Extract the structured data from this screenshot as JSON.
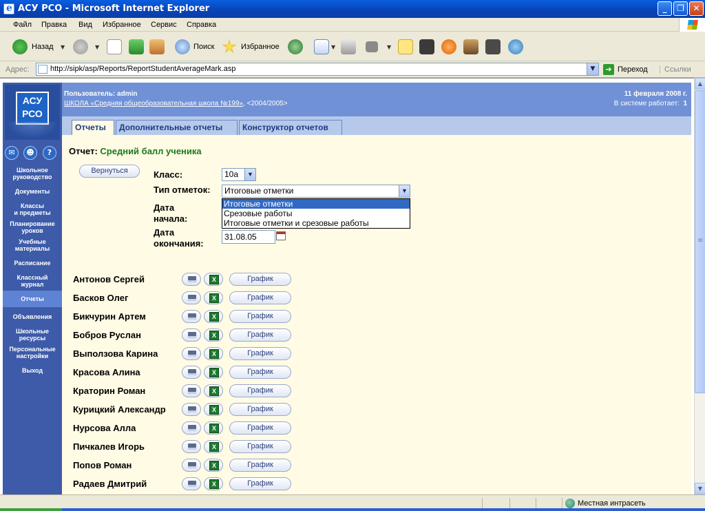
{
  "window": {
    "title": "АСУ РСО - Microsoft Internet Explorer",
    "controls": [
      "_",
      "❐",
      "✕"
    ]
  },
  "menu": [
    "Файл",
    "Правка",
    "Вид",
    "Избранное",
    "Сервис",
    "Справка"
  ],
  "toolbar": {
    "back_label": "Назад",
    "search_label": "Поиск",
    "favorites_label": "Избранное"
  },
  "address": {
    "label": "Адрес:",
    "url": "http://sipk/asp/Reports/ReportStudentAverageMark.asp",
    "go_label": "Переход",
    "links_label": "Ссылки"
  },
  "logo": {
    "line1": "АСУ",
    "line2": "РСО"
  },
  "sidebar": {
    "icons": [
      "mail-icon",
      "users-icon",
      "help-icon"
    ],
    "items": [
      {
        "label": "Школьное\nруководство"
      },
      {
        "label": "Документы"
      },
      {
        "label": "Классы\nи предметы"
      },
      {
        "label": "Планирование\nуроков"
      },
      {
        "label": "Учебные\nматериалы"
      },
      {
        "label": "Расписание"
      },
      {
        "label": "Классный\nжурнал"
      },
      {
        "label": "Отчеты",
        "active": true
      },
      {
        "label": "Объявления"
      },
      {
        "label": "Школьные\nресурсы"
      },
      {
        "label": "Персональные\nнастройки"
      },
      {
        "label": "Выход"
      }
    ]
  },
  "header": {
    "user": "Пользователь: admin",
    "school_link": "ШКОЛА «Средняя общеобразовательная школа №199»",
    "school_year": ", <2004/2005>",
    "date": "11 февраля 2008 г.",
    "online_label": "В системе работает:",
    "online_count": "1"
  },
  "tabs": [
    {
      "label": "Отчеты",
      "active": true
    },
    {
      "label": "Дополнительные отчеты"
    },
    {
      "label": "Конструктор отчетов"
    }
  ],
  "report": {
    "title_prefix": "Отчет:",
    "title_value": "Средний балл ученика",
    "back_button": "Вернуться",
    "class_label": "Класс:",
    "class_value": "10а",
    "marks_type_label": "Тип отметок:",
    "marks_type_value": "Итоговые отметки",
    "marks_type_options": [
      "Итоговые отметки",
      "Срезовые работы",
      "Итоговые отметки и срезовые работы"
    ],
    "start_date_label": "Дата\nначала:",
    "end_date_label": "Дата\nокончания:",
    "end_date_value": "31.08.05",
    "chart_button": "График"
  },
  "students": [
    "Антонов Сергей",
    "Басков Олег",
    "Бикчурин Артем",
    "Бобров Руслан",
    "Выползова Карина",
    "Красова Алина",
    "Краторин Роман",
    "Курицкий Александр",
    "Нурсова Алла",
    "Пичкалев Игорь",
    "Попов Роман",
    "Радаев Дмитрий"
  ],
  "status": {
    "zone": "Местная интрасеть"
  }
}
